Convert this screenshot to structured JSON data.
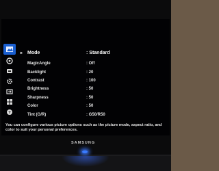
{
  "brand": "SAMSUNG",
  "menu": {
    "rows": [
      {
        "label": "Mode",
        "value": ": Standard"
      },
      {
        "label": "MagicAngle",
        "value": ": Off"
      },
      {
        "label": "Backlight",
        "value": ": 20"
      },
      {
        "label": "Contrast",
        "value": ": 100"
      },
      {
        "label": "Brightness",
        "value": ": 50"
      },
      {
        "label": "Sharpness",
        "value": ": 50"
      },
      {
        "label": "Color",
        "value": ": 50"
      },
      {
        "label": "Tint (G/R)",
        "value": ": G50/R50"
      }
    ],
    "selected_arrow": "▸"
  },
  "help_text": "You can configure various picture options such as the picture mode, aspect ratio, and color to suit your personal preferences.",
  "sidebar_icons": [
    "picture-icon",
    "sound-icon",
    "channel-icon",
    "setup-icon",
    "input-icon",
    "application-icon",
    "support-icon"
  ],
  "colors": {
    "accent": "#1a5fd0",
    "led": "#3a7bff"
  }
}
